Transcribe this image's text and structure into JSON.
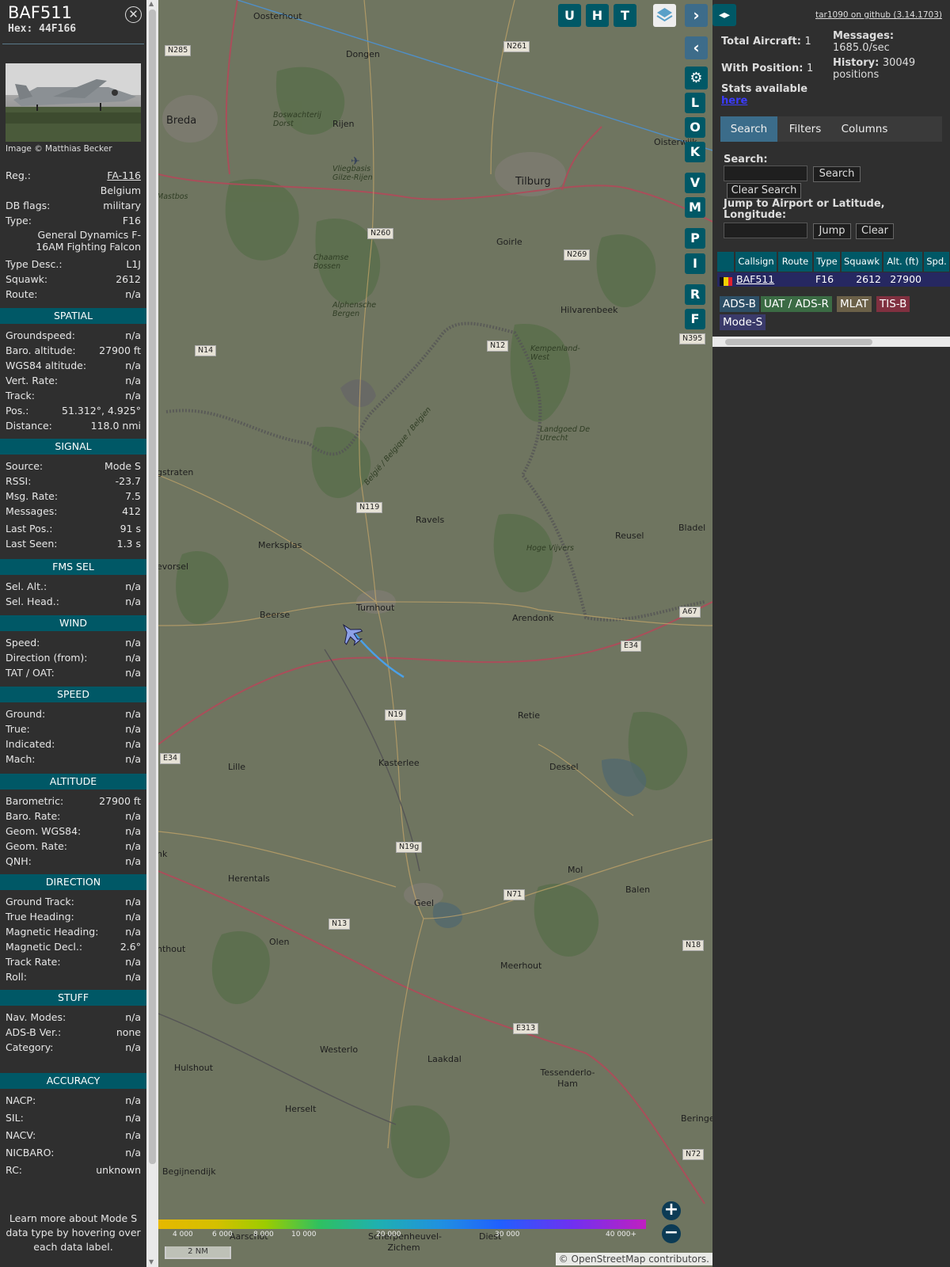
{
  "info": {
    "callsign": "BAF511",
    "hex": "Hex: 44F166",
    "photo_credit": "Image © Matthias Becker",
    "general": [
      {
        "k": "Reg.:",
        "v": "FA-116"
      },
      {
        "k": "",
        "v": "Belgium"
      },
      {
        "k": "DB flags:",
        "v": "military"
      },
      {
        "k": "Type:",
        "v": "F16"
      },
      {
        "k": "",
        "v": "General Dynamics F-16AM Fighting Falcon"
      },
      {
        "k": "Type Desc.:",
        "v": "L1J"
      },
      {
        "k": "Squawk:",
        "v": "2612"
      },
      {
        "k": "Route:",
        "v": "n/a"
      }
    ],
    "sections": [
      {
        "title": "SPATIAL",
        "rows": [
          {
            "k": "Groundspeed:",
            "v": "n/a"
          },
          {
            "k": "Baro. altitude:",
            "v": "27900 ft"
          },
          {
            "k": "WGS84 altitude:",
            "v": "n/a"
          },
          {
            "k": "Vert. Rate:",
            "v": "n/a"
          },
          {
            "k": "Track:",
            "v": "n/a"
          },
          {
            "k": "Pos.:",
            "v": "51.312°, 4.925°"
          },
          {
            "k": "Distance:",
            "v": "118.0 nmi"
          }
        ]
      },
      {
        "title": "SIGNAL",
        "rows": [
          {
            "k": "Source:",
            "v": "Mode S"
          },
          {
            "k": "RSSI:",
            "v": "-23.7"
          },
          {
            "k": "Msg. Rate:",
            "v": "7.5"
          },
          {
            "k": "Messages:",
            "v": "412"
          },
          {
            "k": "Last Pos.:",
            "v": "91 s"
          },
          {
            "k": "Last Seen:",
            "v": "1.3 s"
          }
        ]
      },
      {
        "title": "FMS SEL",
        "rows": [
          {
            "k": "Sel. Alt.:",
            "v": "n/a"
          },
          {
            "k": "Sel. Head.:",
            "v": "n/a"
          }
        ]
      },
      {
        "title": "WIND",
        "rows": [
          {
            "k": "Speed:",
            "v": "n/a"
          },
          {
            "k": "Direction (from):",
            "v": "n/a"
          },
          {
            "k": "TAT / OAT:",
            "v": "n/a"
          }
        ]
      },
      {
        "title": "SPEED",
        "rows": [
          {
            "k": "Ground:",
            "v": "n/a"
          },
          {
            "k": "True:",
            "v": "n/a"
          },
          {
            "k": "Indicated:",
            "v": "n/a"
          },
          {
            "k": "Mach:",
            "v": "n/a"
          }
        ]
      },
      {
        "title": "ALTITUDE",
        "rows": [
          {
            "k": "Barometric:",
            "v": "27900 ft"
          },
          {
            "k": "Baro. Rate:",
            "v": "n/a"
          },
          {
            "k": "Geom. WGS84:",
            "v": "n/a"
          },
          {
            "k": "Geom. Rate:",
            "v": "n/a"
          },
          {
            "k": "QNH:",
            "v": "n/a"
          }
        ]
      },
      {
        "title": "DIRECTION",
        "rows": [
          {
            "k": "Ground Track:",
            "v": "n/a"
          },
          {
            "k": "True Heading:",
            "v": "n/a"
          },
          {
            "k": "Magnetic Heading:",
            "v": "n/a"
          },
          {
            "k": "Magnetic Decl.:",
            "v": "2.6°"
          },
          {
            "k": "Track Rate:",
            "v": "n/a"
          },
          {
            "k": "Roll:",
            "v": "n/a"
          }
        ]
      },
      {
        "title": "STUFF",
        "rows": [
          {
            "k": "Nav. Modes:",
            "v": "n/a"
          },
          {
            "k": "ADS-B Ver.:",
            "v": "none"
          },
          {
            "k": "Category:",
            "v": "n/a"
          }
        ]
      },
      {
        "title": "ACCURACY",
        "rows": [
          {
            "k": "NACP:",
            "v": "n/a"
          },
          {
            "k": "SIL:",
            "v": "n/a"
          },
          {
            "k": "NACV:",
            "v": "n/a"
          },
          {
            "k": "NICBARO:",
            "v": "n/a"
          },
          {
            "k": "RC:",
            "v": "unknown"
          }
        ]
      }
    ],
    "learn_more": "Learn more about Mode S data type by hovering over each data label."
  },
  "map": {
    "controls_top": [
      "U",
      "H",
      "T"
    ],
    "controls_side": [
      "L",
      "O",
      "K",
      "V",
      "M",
      "P",
      "I",
      "R",
      "F"
    ],
    "towns": [
      {
        "t": "Oosterhout",
        "c": ""
      },
      {
        "t": "Dongen",
        "c": ""
      },
      {
        "t": "Breda",
        "c": "big"
      },
      {
        "t": "Rijen",
        "c": ""
      },
      {
        "t": "Tilburg",
        "c": "big"
      },
      {
        "t": "Oisterwijk",
        "c": ""
      },
      {
        "t": "Goirle",
        "c": ""
      },
      {
        "t": "Hilvarenbeek",
        "c": ""
      },
      {
        "t": "Ravels",
        "c": ""
      },
      {
        "t": "Merksplas",
        "c": ""
      },
      {
        "t": "Reusel",
        "c": ""
      },
      {
        "t": "Bladel",
        "c": ""
      },
      {
        "t": "Beerse",
        "c": ""
      },
      {
        "t": "Turnhout",
        "c": ""
      },
      {
        "t": "Arendonk",
        "c": ""
      },
      {
        "t": "Retie",
        "c": ""
      },
      {
        "t": "Lille",
        "c": ""
      },
      {
        "t": "Kasterlee",
        "c": ""
      },
      {
        "t": "Dessel",
        "c": ""
      },
      {
        "t": "Mol",
        "c": ""
      },
      {
        "t": "Balen",
        "c": ""
      },
      {
        "t": "Herentals",
        "c": ""
      },
      {
        "t": "Geel",
        "c": ""
      },
      {
        "t": "Olen",
        "c": ""
      },
      {
        "t": "Meerhout",
        "c": ""
      },
      {
        "t": "Westerlo",
        "c": ""
      },
      {
        "t": "Laakdal",
        "c": ""
      },
      {
        "t": "Hulshout",
        "c": ""
      },
      {
        "t": "Tessenderlo-Ham",
        "c": ""
      },
      {
        "t": "Herselt",
        "c": ""
      },
      {
        "t": "Beringen",
        "c": ""
      },
      {
        "t": "Begijnendijk",
        "c": ""
      },
      {
        "t": "Aarschot",
        "c": ""
      },
      {
        "t": "Scherpenheuvel-Zichem",
        "c": ""
      },
      {
        "t": "Diest",
        "c": ""
      },
      {
        "t": "gstraten",
        "c": ""
      },
      {
        "t": "evorsel",
        "c": ""
      },
      {
        "t": "nk",
        "c": ""
      },
      {
        "t": "nthout",
        "c": ""
      },
      {
        "t": "Boswachterij Dorst",
        "c": "small"
      },
      {
        "t": "Vliegbasis Gilze-Rijen",
        "c": "small"
      },
      {
        "t": "Chaamse Bossen",
        "c": "small"
      },
      {
        "t": "Alphensche Bergen",
        "c": "small"
      },
      {
        "t": "Kempenland-West",
        "c": "small"
      },
      {
        "t": "Landgoed De Utrecht",
        "c": "small"
      },
      {
        "t": "Hoge Vijvers",
        "c": "small"
      },
      {
        "t": "Mastbos",
        "c": "small"
      },
      {
        "t": "België / Belgique / Belgien",
        "c": "small"
      }
    ],
    "roads": [
      "N285",
      "N261",
      "N260",
      "N269",
      "N14",
      "N12",
      "N119",
      "N19",
      "E34",
      "N19g",
      "N13",
      "N71",
      "E313",
      "N18",
      "N72",
      "A67",
      "E34",
      "N395"
    ],
    "color_scale": [
      "4 000",
      "6 000",
      "8 000",
      "10 000",
      "20 000",
      "30 000",
      "40 000+"
    ],
    "scale_label": "2 NM",
    "attribution": "© OpenStreetMap contributors."
  },
  "side": {
    "github_link": "tar1090 on github (3.14.1703)",
    "stats": {
      "total_label": "Total Aircraft:",
      "total": "1",
      "pos_label": "With Position:",
      "pos": "1",
      "avail_label": "Stats available",
      "here": "here",
      "msg_label": "Messages:",
      "msg": "1685.0/sec",
      "hist_label": "History:",
      "hist": "30049 positions"
    },
    "tabs": [
      "Search",
      "Filters",
      "Columns"
    ],
    "search_label": "Search:",
    "search_btn": "Search",
    "clear_search_btn": "Clear Search",
    "jump_label": "Jump to Airport or Latitude, Longitude:",
    "jump_btn": "Jump",
    "clear_btn": "Clear",
    "table_headers": [
      "Callsign",
      "Route",
      "Type",
      "Squawk",
      "Alt. (ft)",
      "Spd."
    ],
    "table_row": {
      "callsign": "BAF511",
      "type": "F16",
      "squawk": "2612",
      "alt": "27900"
    },
    "badges": [
      "ADS-B",
      "UAT / ADS-R",
      "MLAT",
      "TIS-B",
      "Mode-S"
    ],
    "colors": {
      "adsb": "#2d4f66",
      "uat": "#3b6b44",
      "mlat": "#6b6048",
      "tisb": "#803040",
      "modes": "#3a3a6a",
      "accent": "#005866"
    }
  }
}
